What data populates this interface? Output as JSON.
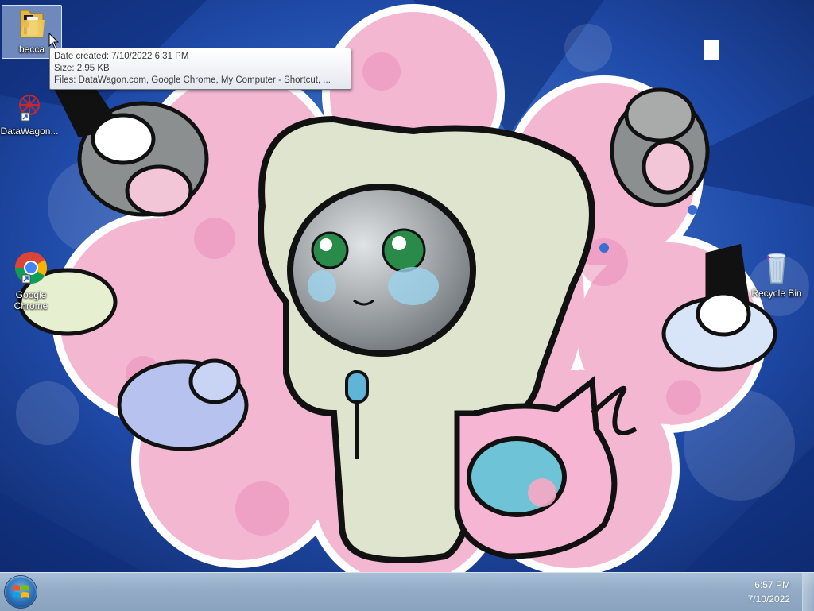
{
  "desktop": {
    "icons": [
      {
        "label": "becca",
        "icon": "folder-icon",
        "selected": true
      },
      {
        "label": "DataWagon...",
        "icon": "datawagon-shortcut-icon"
      },
      {
        "label": "Google Chrome",
        "icon": "chrome-shortcut-icon"
      },
      {
        "label": "Recycle Bin",
        "icon": "recycle-bin-icon"
      }
    ]
  },
  "tooltip": {
    "date_created": "Date created: 7/10/2022 6:31 PM",
    "size": "Size: 2.95 KB",
    "files": "Files: DataWagon.com, Google Chrome, My Computer - Shortcut, ..."
  },
  "taskbar": {
    "start_icon": "windows-logo-icon",
    "clock": {
      "time": "6:57 PM",
      "date": "7/10/2022"
    }
  },
  "colors": {
    "wallpaper_blue": "#1f4aa8",
    "wallpaper_pink": "#f3b7d2",
    "taskbar": "#93abc6"
  }
}
